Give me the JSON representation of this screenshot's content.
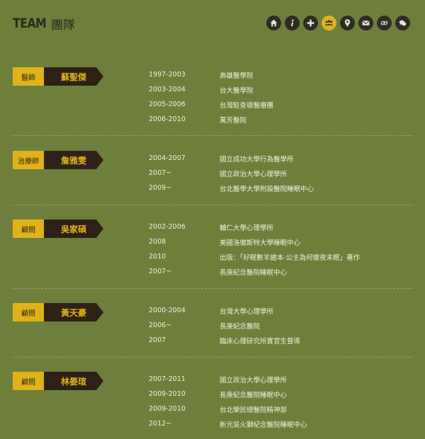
{
  "header": {
    "title_en": "TEAM",
    "title_zh": "團隊"
  },
  "nav_icons": [
    {
      "name": "home-icon",
      "active": false
    },
    {
      "name": "info-icon",
      "active": false
    },
    {
      "name": "plus-icon",
      "active": false
    },
    {
      "name": "team-icon",
      "active": true
    },
    {
      "name": "location-icon",
      "active": false
    },
    {
      "name": "mail-icon",
      "active": false
    },
    {
      "name": "link-icon",
      "active": false
    },
    {
      "name": "chat-icon",
      "active": false
    }
  ],
  "colors": {
    "background": "#6e7f3c",
    "accent": "#e0b21a",
    "dark": "#2e2218",
    "text": "#f1efe1"
  },
  "members": [
    {
      "role": "醫師",
      "name": "蘇聖傑",
      "history": [
        {
          "years": "1997-2003",
          "org": "高雄醫學院"
        },
        {
          "years": "2003-2004",
          "org": "台大醫學院"
        },
        {
          "years": "2005-2006",
          "org": "台灣駐查德醫療團"
        },
        {
          "years": "2006-2010",
          "org": "萬芳醫院"
        }
      ]
    },
    {
      "role": "治療師",
      "name": "詹雅雯",
      "history": [
        {
          "years": "2004-2007",
          "org": "國立成功大學行為醫學所"
        },
        {
          "years": "2007~",
          "org": "國立政治大學心理學所"
        },
        {
          "years": "2009~",
          "org": "台北醫學大學附設醫院睡眠中心"
        }
      ]
    },
    {
      "role": "顧問",
      "name": "吳家碩",
      "history": [
        {
          "years": "2002-2006",
          "org": "輔仁大學心理學所"
        },
        {
          "years": "2008",
          "org": "美國洛徹斯特大學睡眠中心"
        },
        {
          "years": "2010",
          "org": "出版：「好眠數羊繪本-公主為何徹夜未眠」著作"
        },
        {
          "years": "2007~",
          "org": "長庚紀念醫院睡眠中心"
        }
      ]
    },
    {
      "role": "顧問",
      "name": "黃天豪",
      "history": [
        {
          "years": "2000-2004",
          "org": "台灣大學心理學所"
        },
        {
          "years": "2006~",
          "org": "長庚紀念醫院"
        },
        {
          "years": "2007",
          "org": "臨床心理研究所實習生督導"
        }
      ]
    },
    {
      "role": "顧問",
      "name": "林晏瑄",
      "history": [
        {
          "years": "2007-2011",
          "org": "國立政治大學心理學所"
        },
        {
          "years": "2009-2010",
          "org": "長庚紀念醫院睡眠中心"
        },
        {
          "years": "2009-2010",
          "org": "台北榮民總醫院精神部"
        },
        {
          "years": "2012~",
          "org": "新光吳火獅紀念醫院睡眠中心"
        }
      ]
    }
  ]
}
